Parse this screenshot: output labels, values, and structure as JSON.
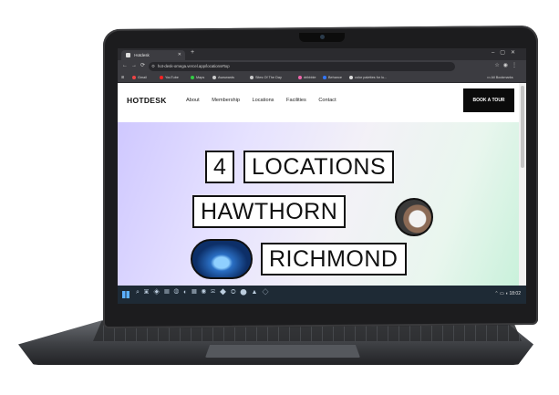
{
  "browser": {
    "tab_title": "Hotdesk",
    "url": "hot-desk-omega.vercel.app/locations#top",
    "bookmarks": [
      "Gmail",
      "YouTube",
      "Maps",
      "Awwwards",
      "Sites Of The Day",
      "dribbble",
      "Behance",
      "color palettes for lu..."
    ],
    "all_bookmarks": "All Bookmarks"
  },
  "site": {
    "logo": "HOTDESK",
    "nav": [
      "About",
      "Membership",
      "Locations",
      "Facilities",
      "Contact"
    ],
    "cta": "BOOK A TOUR"
  },
  "hero": {
    "count": "4",
    "line1": "LOCATIONS",
    "line2": "HAWTHORN",
    "line3": "RICHMOND"
  },
  "taskbar": {
    "time": "18:02"
  },
  "colors": {
    "hero_left": "#cfc8ff",
    "hero_right": "#c9f1db",
    "cta_bg": "#0b0b0b"
  }
}
